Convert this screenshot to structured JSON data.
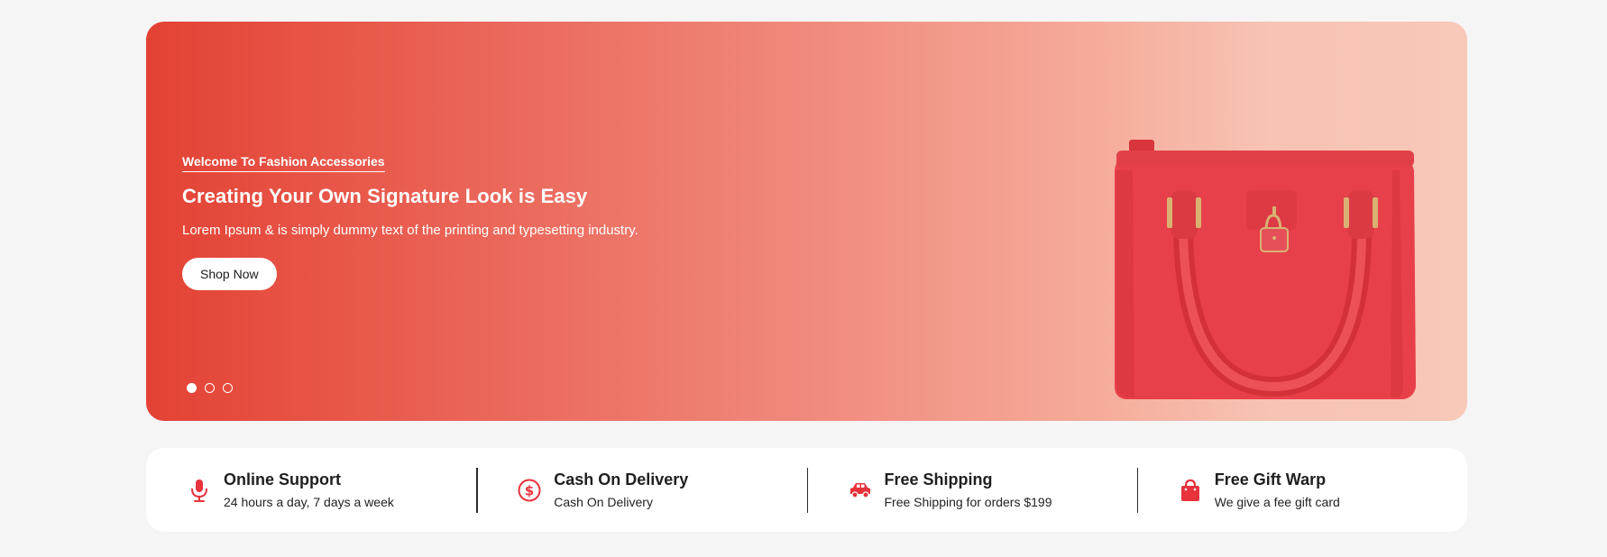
{
  "hero": {
    "kicker": "Welcome To Fashion Accessories",
    "title": "Creating Your Own Signature Look is Easy",
    "description": "Lorem Ipsum & is simply dummy text of the printing and typesetting industry.",
    "cta_label": "Shop Now",
    "slide_count": 3,
    "active_slide": 1,
    "image": "red-handbag",
    "gradient_colors": [
      "#e34234",
      "#f8c8b8"
    ]
  },
  "features": [
    {
      "icon": "microphone-icon",
      "title": "Online Support",
      "subtitle": "24 hours a day, 7 days a week"
    },
    {
      "icon": "dollar-circle-icon",
      "title": "Cash On Delivery",
      "subtitle": "Cash On Delivery"
    },
    {
      "icon": "car-icon",
      "title": "Free Shipping",
      "subtitle": "Free Shipping for orders $199"
    },
    {
      "icon": "shopping-bag-icon",
      "title": "Free Gift Warp",
      "subtitle": "We give a fee gift card"
    }
  ],
  "colors": {
    "accent": "#e8323c",
    "page_bg": "#f5f5f5",
    "card_bg": "#ffffff"
  }
}
